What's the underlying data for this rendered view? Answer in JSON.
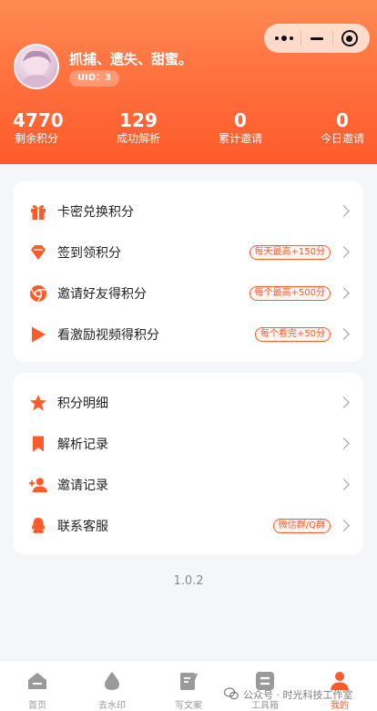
{
  "profile": {
    "name": "抓捕、遗失、甜蜜。",
    "uid_label": "UID：3"
  },
  "stats": [
    {
      "value": "4770",
      "label": "剩余积分"
    },
    {
      "value": "129",
      "label": "成功解析"
    },
    {
      "value": "0",
      "label": "累计邀请"
    },
    {
      "value": "0",
      "label": "今日邀请"
    }
  ],
  "points_menu": [
    {
      "label": "卡密兑换积分",
      "tag": "",
      "icon": "gift-icon"
    },
    {
      "label": "签到领积分",
      "tag": "每天最高+150分",
      "icon": "diamond-icon"
    },
    {
      "label": "邀请好友得积分",
      "tag": "每个最高+500分",
      "icon": "chrome-icon"
    },
    {
      "label": "看激励视频得积分",
      "tag": "每个看完+50分",
      "icon": "play-icon"
    }
  ],
  "records_menu": [
    {
      "label": "积分明细",
      "tag": "",
      "icon": "star-icon"
    },
    {
      "label": "解析记录",
      "tag": "",
      "icon": "bookmark-icon"
    },
    {
      "label": "邀请记录",
      "tag": "",
      "icon": "add-user-icon"
    },
    {
      "label": "联系客服",
      "tag": "微信群/Q群",
      "icon": "qq-icon"
    }
  ],
  "version": "1.0.2",
  "tabbar": [
    {
      "label": "首页",
      "icon": "home-icon",
      "active": false
    },
    {
      "label": "去水印",
      "icon": "drop-icon",
      "active": false
    },
    {
      "label": "写文案",
      "icon": "edit-icon",
      "active": false
    },
    {
      "label": "工具箱",
      "icon": "toolbox-icon",
      "active": false
    },
    {
      "label": "我的",
      "icon": "user-icon",
      "active": true
    }
  ],
  "watermark": "公众号 · 时光科技工作室",
  "colors": {
    "accent": "#ff5a2a",
    "header_top": "#ff8a52",
    "header_bottom": "#ff5a2a",
    "tab_inactive": "#9a9a9a"
  }
}
